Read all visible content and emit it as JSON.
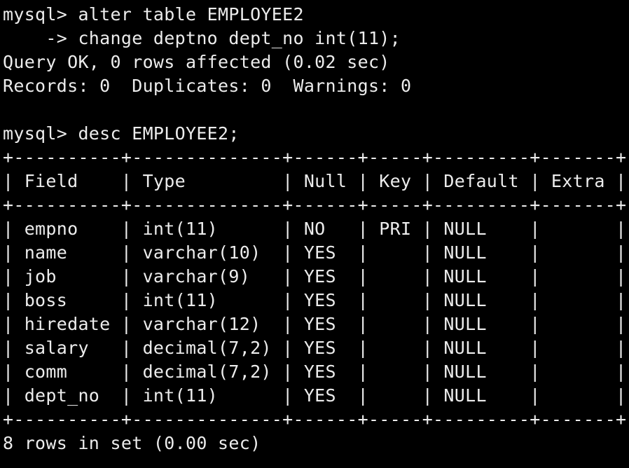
{
  "terminal": {
    "lines": [
      "mysql> alter table EMPLOYEE2",
      "    -> change deptno dept_no int(11);",
      "Query OK, 0 rows affected (0.02 sec)",
      "Records: 0  Duplicates: 0  Warnings: 0",
      "",
      "mysql> desc EMPLOYEE2;",
      "+----------+--------------+------+-----+---------+-------+",
      "| Field    | Type         | Null | Key | Default | Extra |",
      "+----------+--------------+------+-----+---------+-------+",
      "| empno    | int(11)      | NO   | PRI | NULL    |       |",
      "| name     | varchar(10)  | YES  |     | NULL    |       |",
      "| job      | varchar(9)   | YES  |     | NULL    |       |",
      "| boss     | int(11)      | YES  |     | NULL    |       |",
      "| hiredate | varchar(12)  | YES  |     | NULL    |       |",
      "| salary   | decimal(7,2) | YES  |     | NULL    |       |",
      "| comm     | decimal(7,2) | YES  |     | NULL    |       |",
      "| dept_no  | int(11)      | YES  |     | NULL    |       |",
      "+----------+--------------+------+-----+---------+-------+",
      "8 rows in set (0.00 sec)"
    ]
  }
}
